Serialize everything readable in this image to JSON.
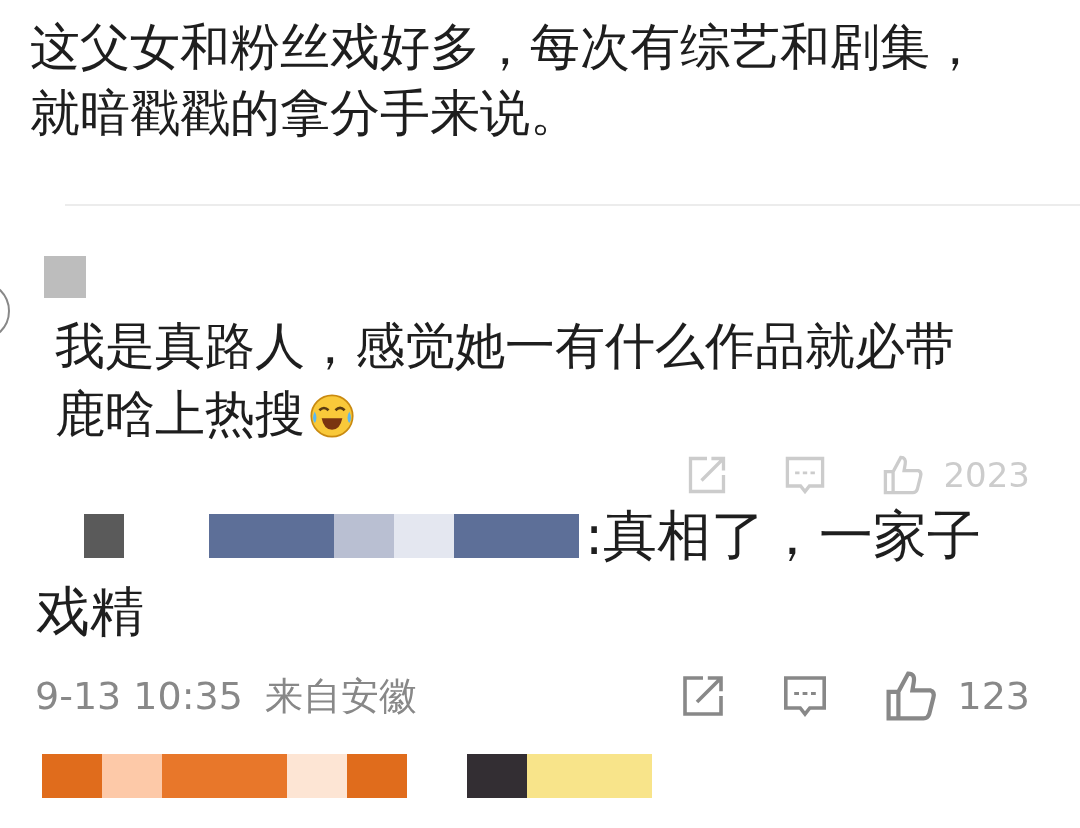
{
  "post": {
    "text": "这父女和粉丝戏好多，每次有综艺和剧集，就暗戳戳的拿分手来说。"
  },
  "comment": {
    "lines": [
      "我是真路人，感觉她一有什么作品就必带",
      "鹿晗上热搜"
    ],
    "like_count": "2023"
  },
  "reply": {
    "lines": [
      ":真相了，一家子",
      "戏精"
    ],
    "time": "9-13 10:35",
    "location": "来自安徽",
    "like_count": "123"
  }
}
